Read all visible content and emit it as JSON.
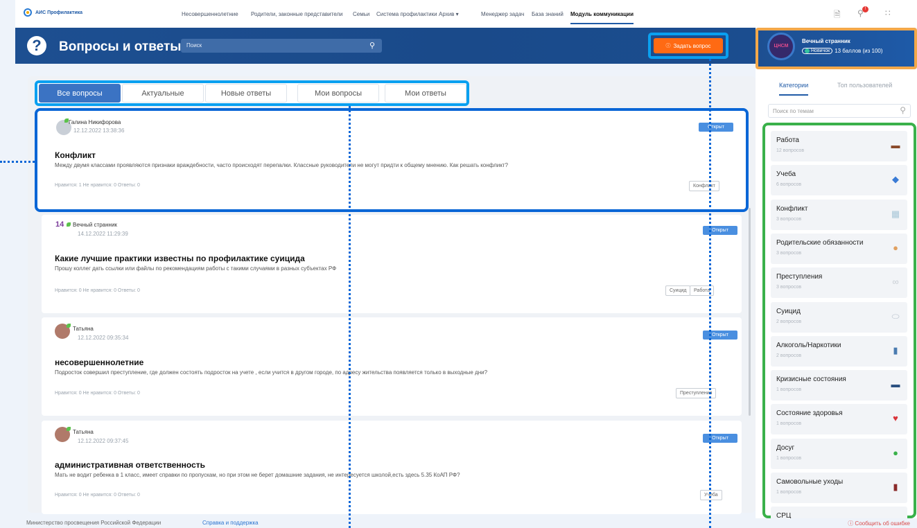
{
  "nav": {
    "logo": "АИС Профилактика",
    "items": [
      "Несовершеннолетние",
      "Родители, законные представители",
      "Семьи",
      "Система профилактики",
      "Архив ▾",
      "Менеджер задач",
      "База знаний",
      "Модуль коммуникации"
    ]
  },
  "header": {
    "title": "Вопросы и ответы",
    "search_placeholder": "Поиск",
    "ask_button": "Задать вопрос"
  },
  "profile": {
    "avatar_text": "ЦНСМ",
    "name": "Вечный странник",
    "level": "Новичок",
    "points": "13 баллов (из 100)"
  },
  "tabs": [
    "Все вопросы",
    "Актуальные",
    "Новые ответы",
    "Мои вопросы",
    "Мои ответы"
  ],
  "questions": [
    {
      "author": "Галина Никифорова",
      "date": "12.12.2022 13:38:36",
      "status": "Открыт",
      "title": "Конфликт",
      "body": "Между двумя классами проявляются признаки враждебности, часто происходят перепалки. Классные руководители не могут придти к общему мнению. Как решать конфликт?",
      "stats": "Нравится: 1   Не нравится: 0   Ответы: 0",
      "tags": [
        "Конфликт"
      ]
    },
    {
      "author": "Вечный странник",
      "date": "14.12.2022 11:29:39",
      "status": "Открыт",
      "title": "Какие лучшие практики известны по профилактике суицида",
      "body": "Прошу коллег дать ссылки или файлы по рекомендациям работы с такими случаями в разных субъектах РФ",
      "stats": "Нравится: 0   Не нравится: 0   Ответы: 0",
      "tags": [
        "Суицид",
        "Работа"
      ]
    },
    {
      "author": "Татьяна",
      "date": "12.12.2022 09:35:34",
      "status": "Открыт",
      "title": "несовершеннолетние",
      "body": "Подросток совершил преступление, где должен состоять подросток на учете , если учится в другом городе, по адресу жительства появляется только в выходные дни?",
      "stats": "Нравится: 0   Не нравится: 0   Ответы: 0",
      "tags": [
        "Преступления"
      ]
    },
    {
      "author": "Татьяна",
      "date": "12.12.2022 09:37:45",
      "status": "Открыт",
      "title": "административная ответственность",
      "body": "Мать не водит ребенка в 1 класс, имеет справки по пропускам, но при этом не берет домашние задания, не интересуется школой,есть здесь 5.35 КоАП РФ?",
      "stats": "Нравится: 0   Не нравится: 0   Ответы: 0",
      "tags": [
        "Учеба"
      ]
    }
  ],
  "sidebar": {
    "tabs": [
      "Категории",
      "Топ пользователей"
    ],
    "search_placeholder": "Поиск по темам",
    "categories": [
      {
        "name": "Работа",
        "count": "12 вопросов",
        "icon": "briefcase-icon",
        "color": "#8a4a2a"
      },
      {
        "name": "Учеба",
        "count": "6 вопросов",
        "icon": "graduation-cap-icon",
        "color": "#3a7bd5"
      },
      {
        "name": "Конфликт",
        "count": "3 вопросов",
        "icon": "conflict-icon",
        "color": "#a9c7d8"
      },
      {
        "name": "Родительские обязанности",
        "count": "3 вопросов",
        "icon": "parent-icon",
        "color": "#e0a060"
      },
      {
        "name": "Преступления",
        "count": "3 вопросов",
        "icon": "handcuffs-icon",
        "color": "#c8ced4"
      },
      {
        "name": "Суицид",
        "count": "2 вопросов",
        "icon": "pills-icon",
        "color": "#b8c2cc"
      },
      {
        "name": "Алкоголь/Наркотики",
        "count": "2 вопросов",
        "icon": "bottle-icon",
        "color": "#4a7bb0"
      },
      {
        "name": "Кризисные состояния",
        "count": "1 вопросов",
        "icon": "bed-icon",
        "color": "#2a4f80"
      },
      {
        "name": "Состояние здоровья",
        "count": "1 вопросов",
        "icon": "heart-icon",
        "color": "#d9343a"
      },
      {
        "name": "Досуг",
        "count": "1 вопросов",
        "icon": "ball-icon",
        "color": "#3ab14a"
      },
      {
        "name": "Самовольные уходы",
        "count": "1 вопросов",
        "icon": "door-icon",
        "color": "#8a2a2a"
      },
      {
        "name": "СРЦ",
        "count": "",
        "icon": "house-icon",
        "color": "#888"
      }
    ]
  },
  "footer": {
    "ministry": "Министерство просвещения Российской Федерации",
    "help": "Справка и поддержка",
    "report": "Сообщить об ошибке"
  },
  "colors": {
    "primary": "#1d4f91",
    "accent": "#ff6a13",
    "highlight_blue": "#0aa0f0",
    "highlight_green": "#3ab14a",
    "highlight_orange": "#f3a84a"
  }
}
